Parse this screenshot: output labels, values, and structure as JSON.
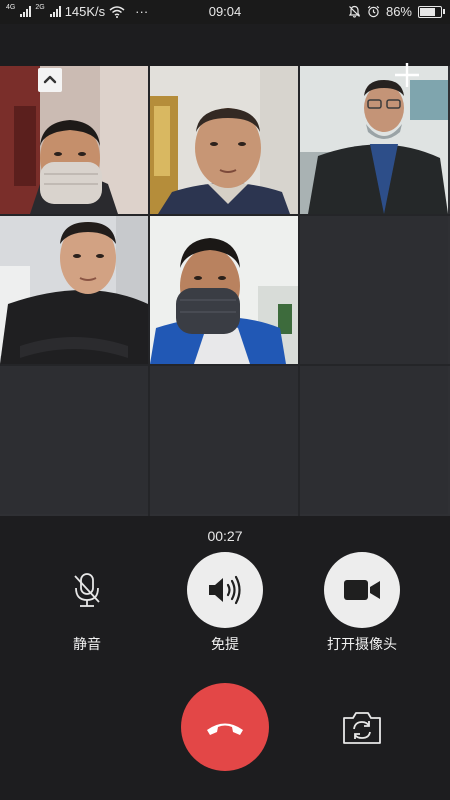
{
  "status_bar": {
    "net1": "4G",
    "net2": "2G",
    "speed": "145K/s",
    "more": "···",
    "time": "09:04",
    "battery": "86%",
    "battery_level": 0.86
  },
  "call": {
    "timer": "00:27"
  },
  "controls": {
    "mute_label": "静音",
    "speaker_label": "免提",
    "camera_label": "打开摄像头"
  },
  "colors": {
    "hangup": "#e34747",
    "control_bg": "#ededed",
    "background": "#1d1d1f"
  },
  "participants": [
    {
      "slot": 1,
      "mask": "light"
    },
    {
      "slot": 2,
      "mask": "none"
    },
    {
      "slot": 3,
      "mask": "chin"
    },
    {
      "slot": 4,
      "mask": "none"
    },
    {
      "slot": 5,
      "mask": "dark"
    }
  ]
}
